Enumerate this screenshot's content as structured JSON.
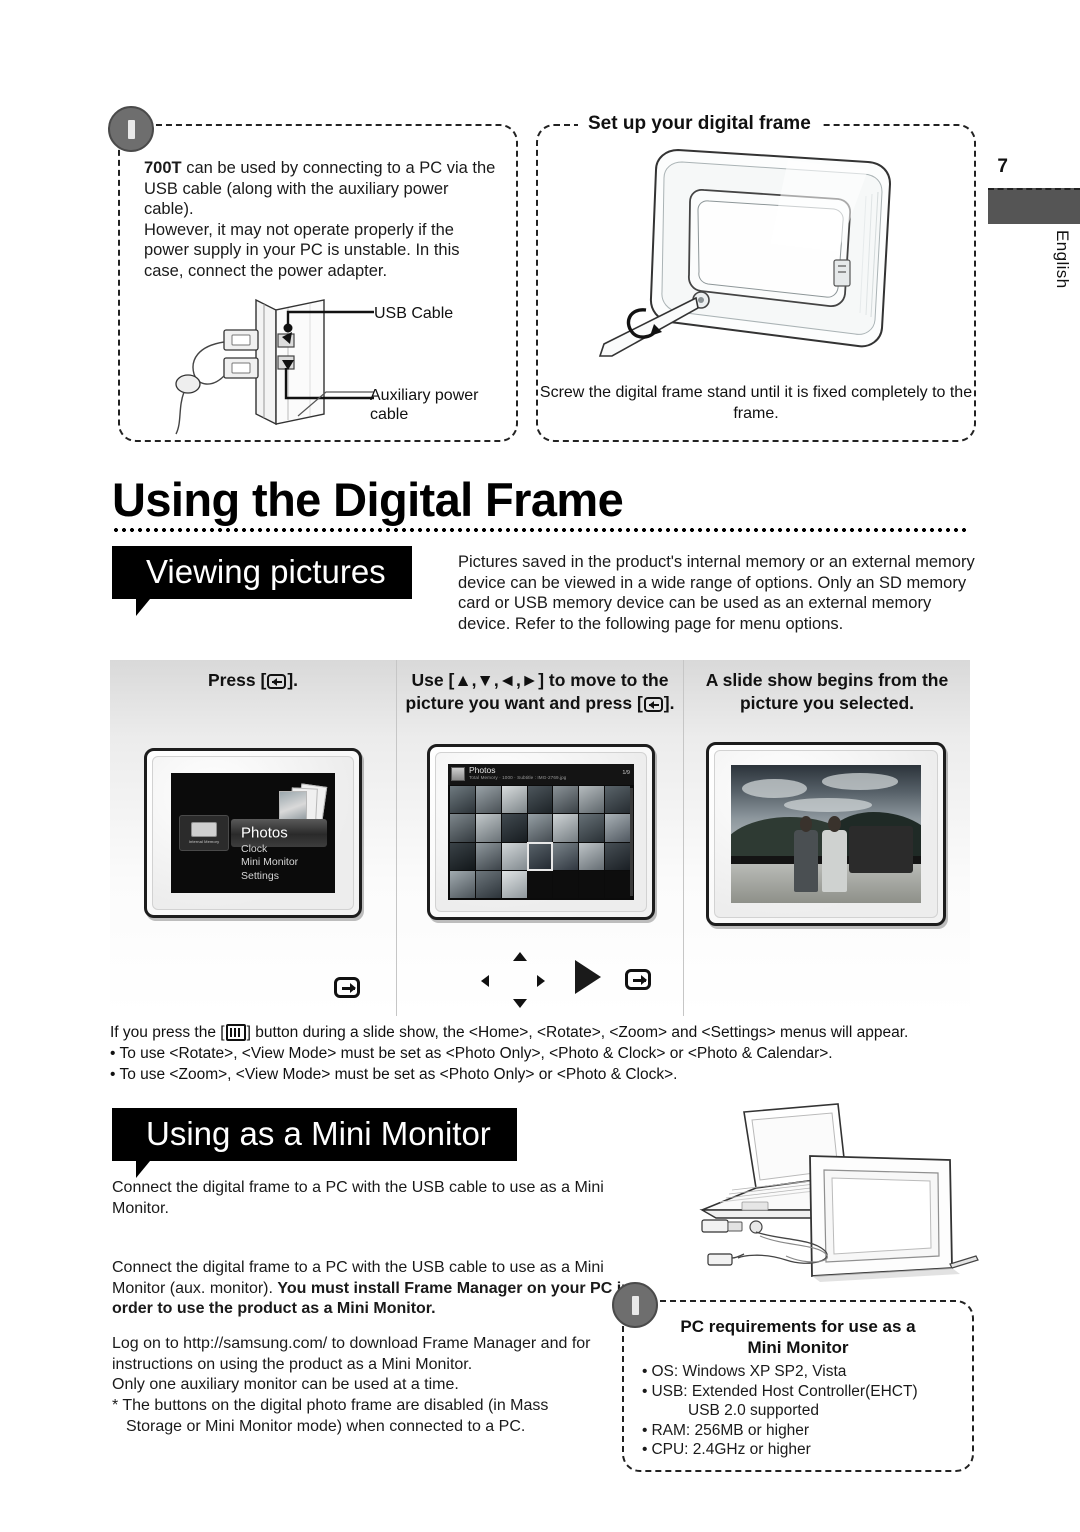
{
  "rail": {
    "page_number": "7",
    "language": "English"
  },
  "note_usb": {
    "icon": "exclamation-icon",
    "lines": [
      "can be used by connecting to a PC via the USB cable (along with the auxiliary power cable).",
      "However, it may not operate properly if the power supply in your PC is unstable. In this case, connect the power adapter."
    ],
    "bold_lead": "700T",
    "callout_usb": "USB Cable",
    "callout_aux": "Auxiliary power cable"
  },
  "note_setup": {
    "title": "Set up your digital frame",
    "caption": "Screw the digital frame stand until it is fixed completely to the frame."
  },
  "main": {
    "title": "Using the Digital Frame"
  },
  "viewing": {
    "tag": "Viewing pictures",
    "intro": "Pictures saved in the product's internal memory or an external memory device can be viewed in a wide range of options. Only an SD memory card or USB memory device can be used as an external memory device. Refer to the following page for menu options."
  },
  "steps": [
    {
      "head_pre": "Press [",
      "head_post": "].",
      "screen": {
        "chip_label": "Internal Memory",
        "selected": "Photos",
        "items": [
          "Clock",
          "Mini Monitor",
          "Settings"
        ]
      }
    },
    {
      "head_pre": "Use [",
      "head_mid": "] to move to the picture you want and press [",
      "head_post": "].",
      "arrows": "▲,▼,◄,►",
      "screen": {
        "title": "Photos",
        "subtitle": "Total Memory  · 1000  ·  Subtitle : IMG-2769.jpg",
        "page": "1/9"
      }
    },
    {
      "head": "A slide show begins from the picture you selected."
    }
  ],
  "steps_notes": {
    "line1_pre": "If you press the [",
    "line1_post": "] button during a slide show, the <Home>, <Rotate>, <Zoom> and <Settings> menus will appear.",
    "bullets": [
      "To use <Rotate>, <View Mode> must be set as <Photo Only>, <Photo & Clock> or <Photo & Calendar>.",
      "To use <Zoom>, <View Mode> must be set as <Photo Only> or <Photo & Clock>."
    ]
  },
  "mini_monitor": {
    "tag": "Using as a Mini Monitor",
    "p1": "Connect the digital frame to a PC with the USB cable to use as a Mini Monitor.",
    "p2_plain": "Connect the digital frame to a PC with the USB cable to use as a Mini Monitor (aux. monitor). ",
    "p2_bold": "You must install Frame Manager on your PC in order to use the product as a Mini Monitor.",
    "p3": "Log on to http://samsung.com/ to download Frame Manager and for instructions on using the product as a Mini Monitor.\nOnly one auxiliary monitor can be used at a time.",
    "p4_a": "* The buttons on the digital photo frame are disabled (in Mass",
    "p4_b": "Storage or Mini Monitor mode) when connected to a PC."
  },
  "pc_req": {
    "title_line1": "PC requirements for use as a",
    "title_line2": "Mini Monitor",
    "items": [
      "OS: Windows XP SP2, Vista",
      "USB: Extended Host Controller(EHCT)",
      "USB 2.0 supported",
      "RAM: 256MB or higher",
      "CPU: 2.4GHz or higher"
    ]
  },
  "colors": {
    "tag_bg": "#000000",
    "rail_block": "#555555",
    "icon_gray": "#6e6e6e"
  }
}
